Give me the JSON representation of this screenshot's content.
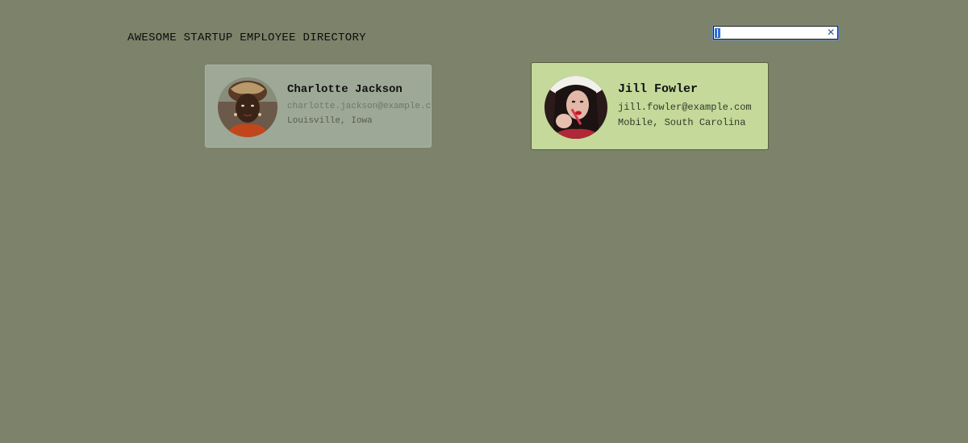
{
  "header": {
    "title": "AWESOME STARTUP EMPLOYEE DIRECTORY"
  },
  "search": {
    "value": "",
    "clear_icon": "close-icon",
    "clear_glyph": "✕"
  },
  "employees": [
    {
      "name": "Charlotte Jackson",
      "email": "charlotte.jackson@example.com",
      "location": "Louisville, Iowa",
      "card_color": "#9ea896"
    },
    {
      "name": "Jill Fowler",
      "email": "jill.fowler@example.com",
      "location": "Mobile, South Carolina",
      "card_color": "#c4d99a"
    }
  ],
  "colors": {
    "background": "#7d826a",
    "search_selection": "#2f6fd8",
    "clear_icon": "#2d5a8c"
  }
}
